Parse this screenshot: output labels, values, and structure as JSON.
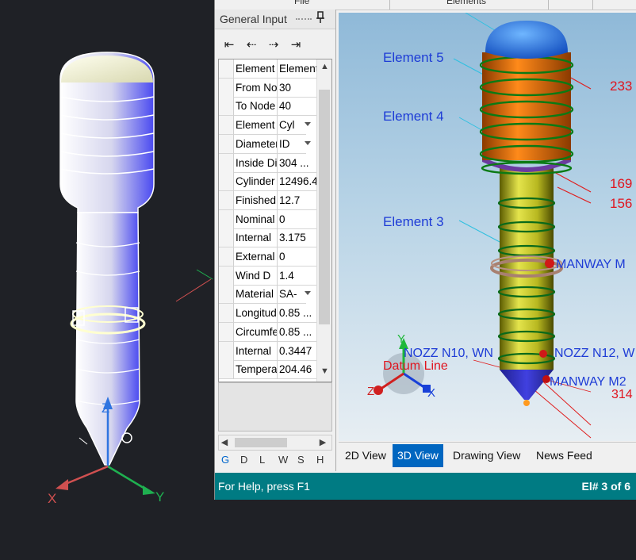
{
  "top_strip": {
    "partial_1": "File",
    "partial_2": "Elements"
  },
  "panel": {
    "title": "General Input",
    "nav_first": "⇤",
    "nav_prev": "⇠",
    "nav_next": "⇢",
    "nav_last": "⇥",
    "rows": [
      {
        "name": "Element",
        "value": "Element",
        "dropdown": false
      },
      {
        "name": "From Node",
        "value": "30",
        "dropdown": false
      },
      {
        "name": "To Node",
        "value": "40",
        "dropdown": false
      },
      {
        "name": "Element Type",
        "value": "Cyl",
        "dropdown": true
      },
      {
        "name": "Diameter",
        "value": "ID",
        "dropdown": true
      },
      {
        "name": "Inside Diameter",
        "value": "304 ...",
        "dropdown": false
      },
      {
        "name": "Cylinder",
        "value": "12496.4",
        "dropdown": false
      },
      {
        "name": "Finished",
        "value": "12.7",
        "dropdown": false
      },
      {
        "name": "Nominal",
        "value": "0",
        "dropdown": false
      },
      {
        "name": "Internal",
        "value": "3.175",
        "dropdown": false
      },
      {
        "name": "External",
        "value": "0",
        "dropdown": false
      },
      {
        "name": "Wind D",
        "value": "1.4",
        "dropdown": false
      },
      {
        "name": "Material",
        "value": "SA-",
        "dropdown": true
      },
      {
        "name": "Longitudinal",
        "value": "0.85 ...",
        "dropdown": false
      },
      {
        "name": "Circumferential",
        "value": "0.85 ...",
        "dropdown": false
      },
      {
        "name": "Internal",
        "value": "0.3447",
        "dropdown": false
      },
      {
        "name": "Temperature",
        "value": "204.46",
        "dropdown": false
      }
    ],
    "vertical_tabs": [
      "G",
      "D",
      "L",
      "W",
      "S",
      "H"
    ]
  },
  "viewport": {
    "labels": {
      "element5": "Element  5",
      "element4": "Element  4",
      "element3": "Element  3",
      "n1": "233",
      "n2": "169",
      "n3": "156",
      "manway1": "MANWAY M",
      "nozz1": "NOZZ N10, WN",
      "nozz2": "NOZZ N12, W",
      "datum": "Datum Line",
      "manway2": "MANWAY M2",
      "n4": "314",
      "axis_x": "X",
      "axis_y": "Y",
      "axis_z": "Z"
    },
    "tabs": [
      "2D View",
      "3D View",
      "Drawing View",
      "News Feed"
    ],
    "active_tab": "3D View"
  },
  "status": {
    "help": "For Help, press F1",
    "element": "El# 3 of 6"
  },
  "cad_axes": {
    "x": "X",
    "y": "Y",
    "z": "Z"
  },
  "colors": {
    "accent": "#0066c0",
    "statusbar": "#007b83",
    "label_blue": "#1e3cd6",
    "label_red": "#e0141e"
  }
}
